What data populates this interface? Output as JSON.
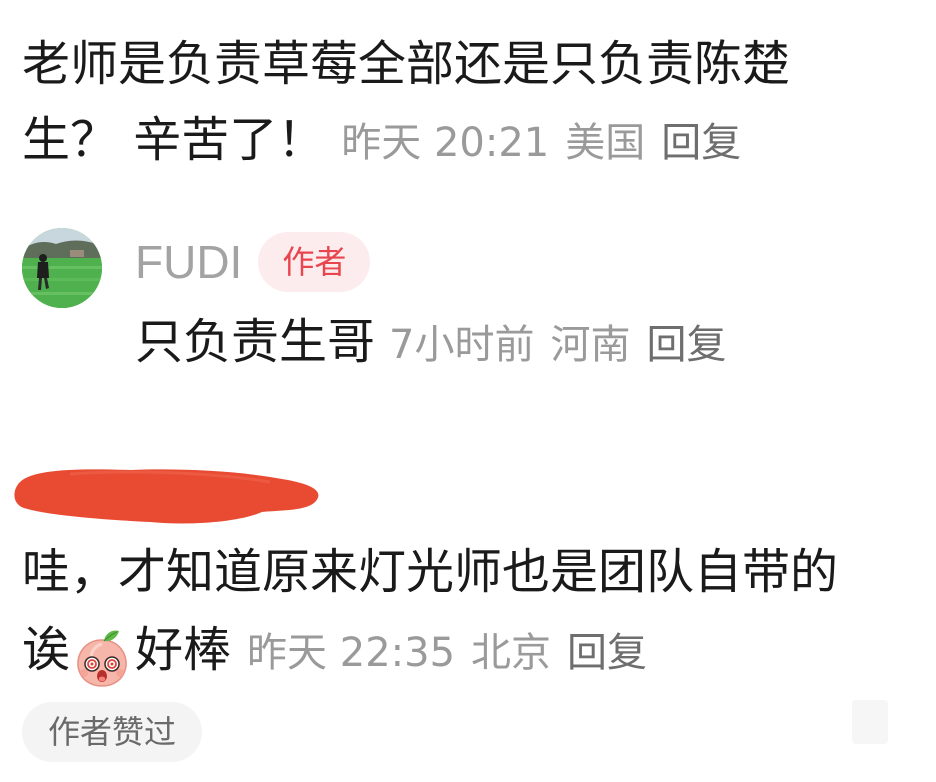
{
  "comment1": {
    "text_lines": [
      "老师是负责草莓全部还是只负责陈楚",
      "生？ 辛苦了！"
    ],
    "time": "昨天 20:21",
    "location": "美国",
    "reply_label": "回复"
  },
  "author_reply": {
    "avatar_icon": "avatar-photo",
    "username": "FUDI",
    "author_badge": "作者",
    "text": "只负责生哥",
    "time": "7小时前",
    "location": "河南",
    "reply_label": "回复"
  },
  "comment2": {
    "username_redaction_icon": "red-scribble-redaction",
    "text_line1": "哇，才知道原来灯光师也是团队自带的",
    "text_line2_before_emoji": "诶",
    "emoji_icon": "peach-face-emoji",
    "text_line2_after_emoji": "好棒",
    "time": "昨天 22:35",
    "location": "北京",
    "reply_label": "回复",
    "liked_badge": "作者赞过"
  },
  "colors": {
    "text": "#1a1a1a",
    "meta": "#9a9a9a",
    "username": "#a3a3a3",
    "author_badge_bg": "#fdecee",
    "author_badge_text": "#e8454f",
    "redaction": "#e94a32",
    "liked_pill_bg": "#f4f4f4"
  }
}
